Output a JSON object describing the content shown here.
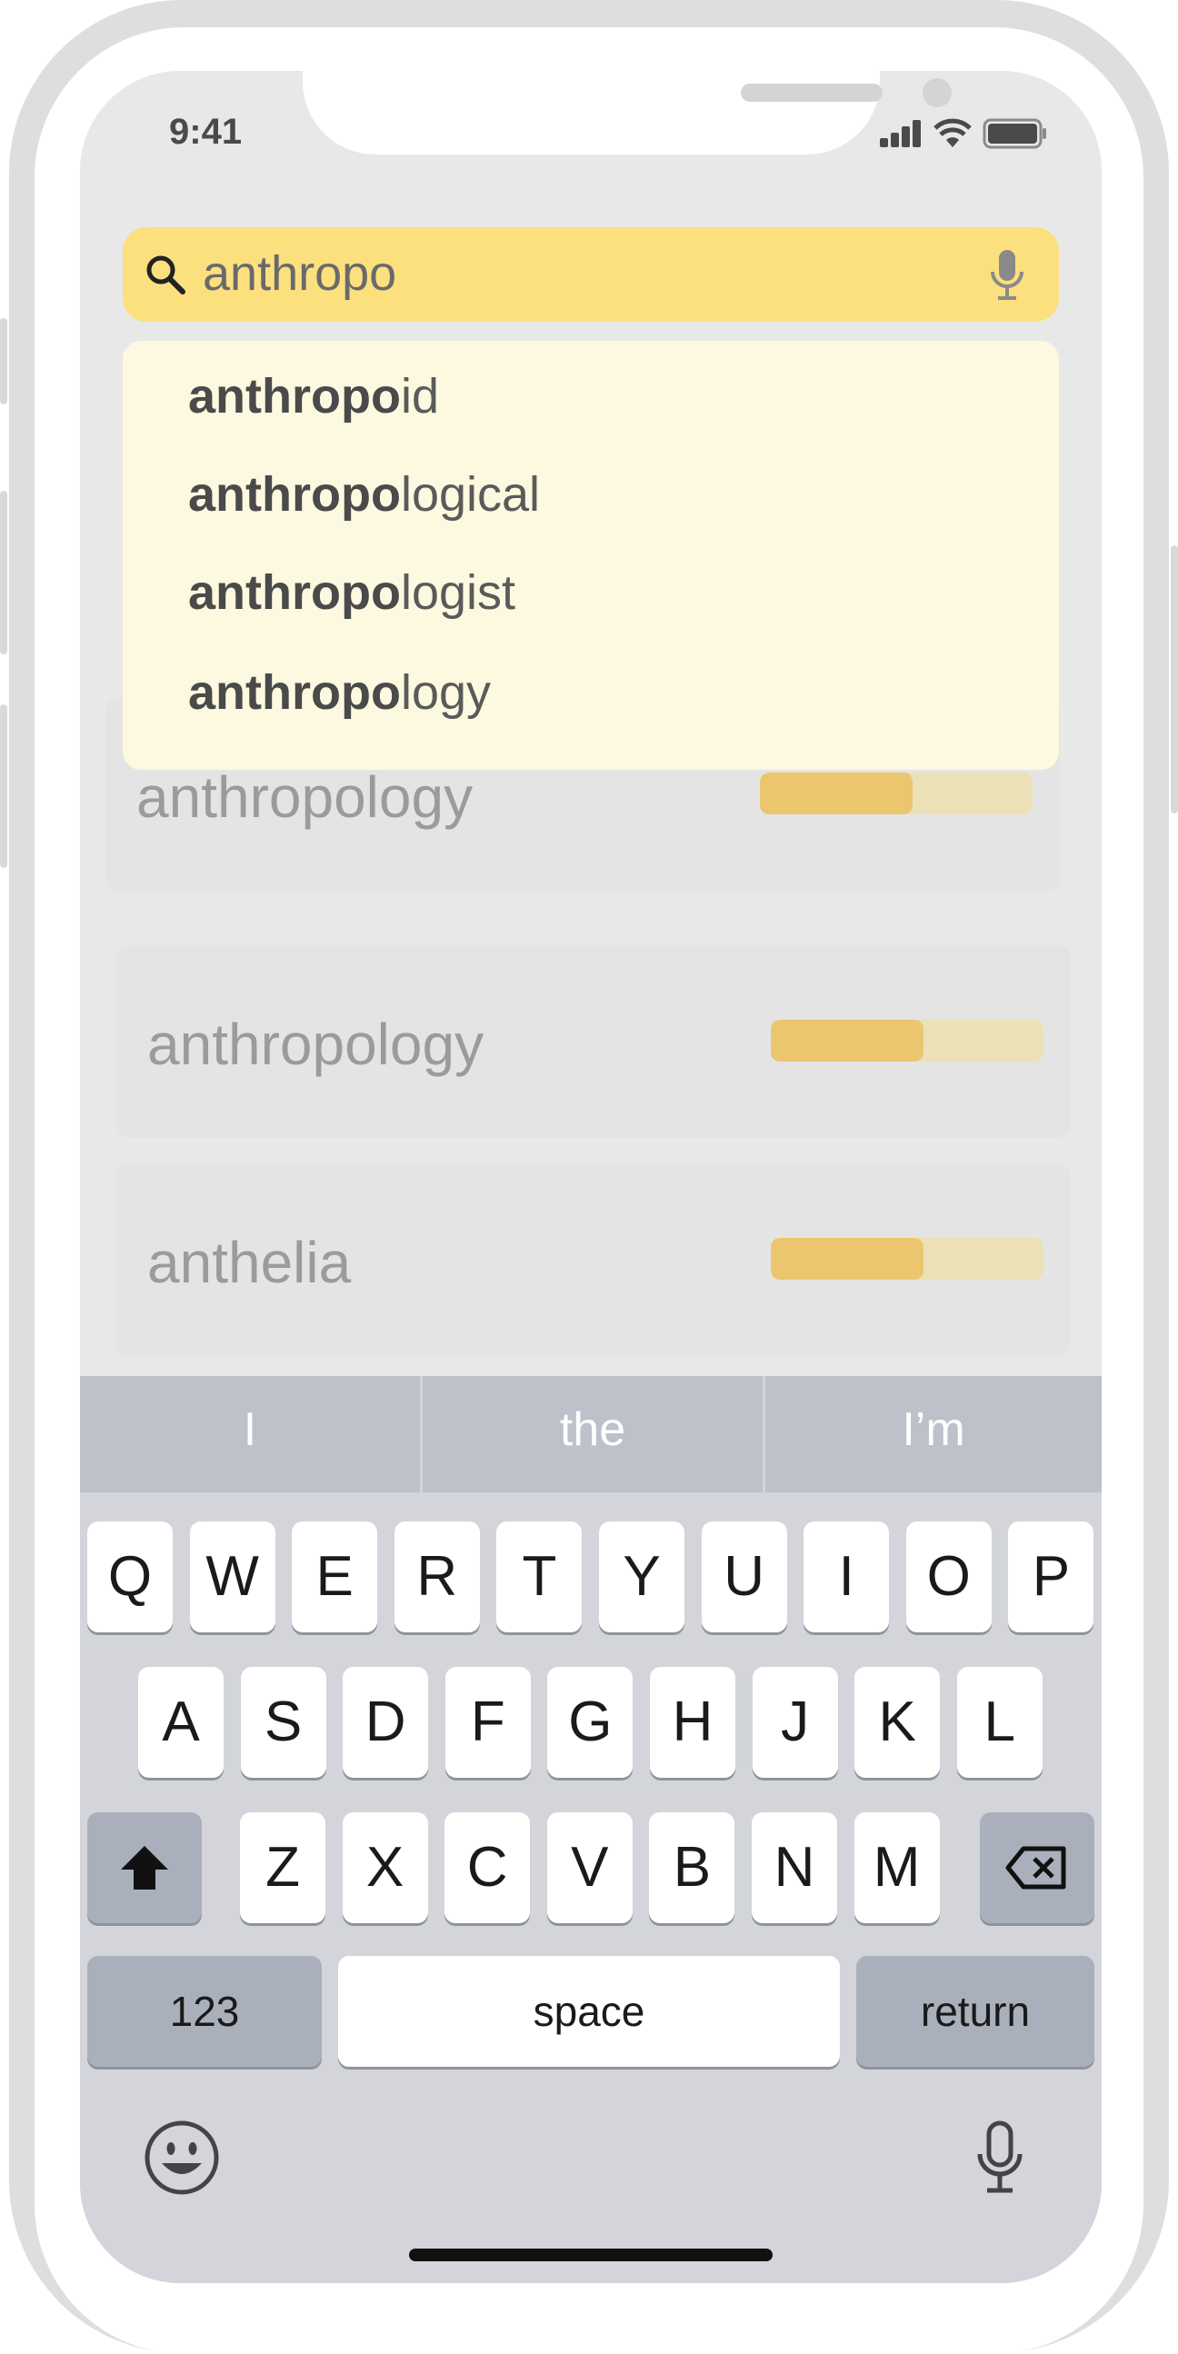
{
  "status_bar": {
    "time": "9:41",
    "icons": [
      "signal-icon",
      "wifi-icon",
      "battery-icon"
    ]
  },
  "search": {
    "value": "anthropo",
    "icons": [
      "search-icon",
      "microphone-icon"
    ],
    "accent_color": "#fde07e"
  },
  "suggestions": [
    {
      "match": "anthropo",
      "rest": "id"
    },
    {
      "match": "anthropo",
      "rest": "logical"
    },
    {
      "match": "anthropo",
      "rest": "logist"
    },
    {
      "match": "anthropo",
      "rest": "logy"
    }
  ],
  "word_cards": [
    {
      "word": "anthropology",
      "progress": 0.56
    },
    {
      "word": "anthropology",
      "progress": 0.56
    },
    {
      "word": "anthelia",
      "progress": 0.56
    }
  ],
  "keyboard": {
    "predictions": [
      "I",
      "the",
      "I’m"
    ],
    "row1": [
      "Q",
      "W",
      "E",
      "R",
      "T",
      "Y",
      "U",
      "I",
      "O",
      "P"
    ],
    "row2": [
      "A",
      "S",
      "D",
      "F",
      "G",
      "H",
      "J",
      "K",
      "L"
    ],
    "row3": [
      "Z",
      "X",
      "C",
      "V",
      "B",
      "N",
      "M"
    ],
    "numbers_label": "123",
    "space_label": "space",
    "return_label": "return",
    "icons": [
      "shift-icon",
      "delete-icon",
      "emoji-icon",
      "dictation-icon"
    ]
  }
}
